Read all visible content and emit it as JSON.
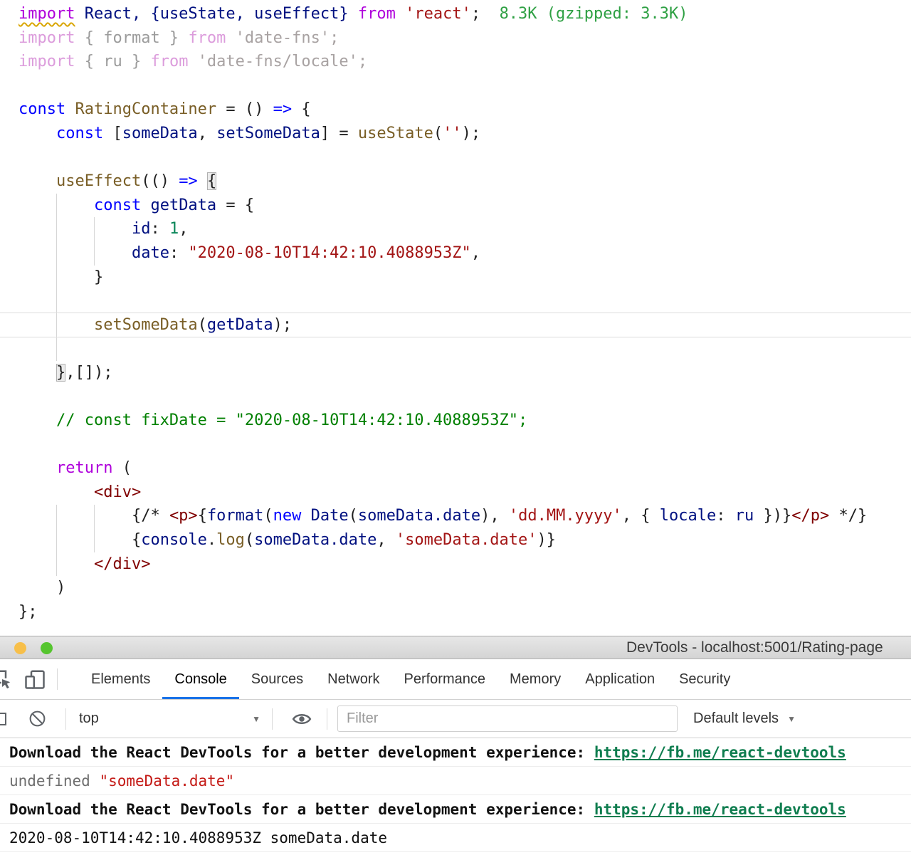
{
  "icons": {
    "caret_down": "▼"
  },
  "editor": {
    "current_line": 13,
    "guides": [
      {
        "col": 4,
        "from": 8,
        "to": 14
      },
      {
        "col": 8,
        "from": 9,
        "to": 10
      },
      {
        "col": 4,
        "from": 21,
        "to": 23
      },
      {
        "col": 8,
        "from": 21,
        "to": 22
      }
    ],
    "lines": [
      [
        {
          "t": "import",
          "c": "kw2 sq"
        },
        {
          "t": " ",
          "c": "plain"
        },
        {
          "t": "React, {useState, useEffect}",
          "c": "var"
        },
        {
          "t": " ",
          "c": "plain"
        },
        {
          "t": "from",
          "c": "kw2"
        },
        {
          "t": " ",
          "c": "plain"
        },
        {
          "t": "'react'",
          "c": "str"
        },
        {
          "t": ";",
          "c": "plain"
        },
        {
          "t": "  ",
          "c": "plain"
        },
        {
          "t": "8.3K (gzipped: 3.3K)",
          "c": "cost"
        }
      ],
      [
        {
          "t": "import",
          "c": "fkw"
        },
        {
          "t": " { format } ",
          "c": "fplain"
        },
        {
          "t": "from",
          "c": "fkw"
        },
        {
          "t": " ",
          "c": "fplain"
        },
        {
          "t": "'date-fns';",
          "c": "fstr"
        }
      ],
      [
        {
          "t": "import",
          "c": "fkw"
        },
        {
          "t": " { ru } ",
          "c": "fplain"
        },
        {
          "t": "from",
          "c": "fkw"
        },
        {
          "t": " ",
          "c": "fplain"
        },
        {
          "t": "'date-fns/locale';",
          "c": "fstr"
        }
      ],
      [],
      [
        {
          "t": "const",
          "c": "kw"
        },
        {
          "t": " ",
          "c": "plain"
        },
        {
          "t": "RatingContainer",
          "c": "fn"
        },
        {
          "t": " = () ",
          "c": "plain"
        },
        {
          "t": "=>",
          "c": "kw"
        },
        {
          "t": " {",
          "c": "plain"
        }
      ],
      [
        {
          "t": "    ",
          "c": "plain"
        },
        {
          "t": "const",
          "c": "kw"
        },
        {
          "t": " [",
          "c": "plain"
        },
        {
          "t": "someData",
          "c": "var"
        },
        {
          "t": ", ",
          "c": "plain"
        },
        {
          "t": "setSomeData",
          "c": "var"
        },
        {
          "t": "] = ",
          "c": "plain"
        },
        {
          "t": "useState",
          "c": "fn"
        },
        {
          "t": "(",
          "c": "plain"
        },
        {
          "t": "''",
          "c": "str"
        },
        {
          "t": ");",
          "c": "plain"
        }
      ],
      [],
      [
        {
          "t": "    ",
          "c": "plain"
        },
        {
          "t": "useEffect",
          "c": "fn"
        },
        {
          "t": "(() ",
          "c": "plain"
        },
        {
          "t": "=>",
          "c": "kw"
        },
        {
          "t": " ",
          "c": "plain"
        },
        {
          "t": "{",
          "c": "plain hl"
        }
      ],
      [
        {
          "t": "        ",
          "c": "plain"
        },
        {
          "t": "const",
          "c": "kw"
        },
        {
          "t": " ",
          "c": "plain"
        },
        {
          "t": "getData",
          "c": "var"
        },
        {
          "t": " = {",
          "c": "plain"
        }
      ],
      [
        {
          "t": "            ",
          "c": "plain"
        },
        {
          "t": "id",
          "c": "var"
        },
        {
          "t": ": ",
          "c": "plain"
        },
        {
          "t": "1",
          "c": "num"
        },
        {
          "t": ",",
          "c": "plain"
        }
      ],
      [
        {
          "t": "            ",
          "c": "plain"
        },
        {
          "t": "date",
          "c": "var"
        },
        {
          "t": ": ",
          "c": "plain"
        },
        {
          "t": "\"2020-08-10T14:42:10.4088953Z\"",
          "c": "str"
        },
        {
          "t": ",",
          "c": "plain"
        }
      ],
      [
        {
          "t": "        }",
          "c": "plain"
        }
      ],
      [],
      [
        {
          "t": "        ",
          "c": "plain"
        },
        {
          "t": "setSomeData",
          "c": "fn"
        },
        {
          "t": "(",
          "c": "plain"
        },
        {
          "t": "getData",
          "c": "var"
        },
        {
          "t": ");",
          "c": "plain"
        }
      ],
      [],
      [
        {
          "t": "    ",
          "c": "plain"
        },
        {
          "t": "}",
          "c": "plain hl"
        },
        {
          "t": ",[]);",
          "c": "plain"
        }
      ],
      [],
      [
        {
          "t": "    ",
          "c": "plain"
        },
        {
          "t": "// const fixDate = \"2020-08-10T14:42:10.4088953Z\";",
          "c": "comment"
        }
      ],
      [],
      [
        {
          "t": "    ",
          "c": "plain"
        },
        {
          "t": "return",
          "c": "kw2"
        },
        {
          "t": " (",
          "c": "plain"
        }
      ],
      [
        {
          "t": "        ",
          "c": "plain"
        },
        {
          "t": "<div>",
          "c": "tag"
        }
      ],
      [
        {
          "t": "            ",
          "c": "plain"
        },
        {
          "t": "{/* ",
          "c": "plain"
        },
        {
          "t": "<p>",
          "c": "tag"
        },
        {
          "t": "{",
          "c": "plain"
        },
        {
          "t": "format",
          "c": "var"
        },
        {
          "t": "(",
          "c": "plain"
        },
        {
          "t": "new",
          "c": "kw"
        },
        {
          "t": " ",
          "c": "plain"
        },
        {
          "t": "Date",
          "c": "var"
        },
        {
          "t": "(",
          "c": "plain"
        },
        {
          "t": "someData.date",
          "c": "var"
        },
        {
          "t": "), ",
          "c": "plain"
        },
        {
          "t": "'dd.MM.yyyy'",
          "c": "str"
        },
        {
          "t": ", { ",
          "c": "plain"
        },
        {
          "t": "locale",
          "c": "var"
        },
        {
          "t": ": ",
          "c": "plain"
        },
        {
          "t": "ru",
          "c": "var"
        },
        {
          "t": " })}",
          "c": "plain"
        },
        {
          "t": "</p>",
          "c": "tag"
        },
        {
          "t": " */}",
          "c": "plain"
        }
      ],
      [
        {
          "t": "            ",
          "c": "plain"
        },
        {
          "t": "{",
          "c": "plain"
        },
        {
          "t": "console",
          "c": "var"
        },
        {
          "t": ".",
          "c": "plain"
        },
        {
          "t": "log",
          "c": "fn"
        },
        {
          "t": "(",
          "c": "plain"
        },
        {
          "t": "someData.date",
          "c": "var"
        },
        {
          "t": ", ",
          "c": "plain"
        },
        {
          "t": "'someData.date'",
          "c": "str"
        },
        {
          "t": ")}",
          "c": "plain"
        }
      ],
      [
        {
          "t": "        ",
          "c": "plain"
        },
        {
          "t": "</div>",
          "c": "tag"
        }
      ],
      [
        {
          "t": "    )",
          "c": "plain"
        }
      ],
      [
        {
          "t": "};",
          "c": "plain"
        }
      ]
    ]
  },
  "devtools": {
    "window_title": "DevTools - localhost:5001/Rating-page",
    "colors": {
      "traffic_yellow": "#f7bf4a",
      "traffic_green": "#56c52f",
      "tab_accent": "#1a73e8",
      "link_green": "#0f7d4f",
      "string_red": "#c41a16"
    },
    "tabs": [
      "Elements",
      "Console",
      "Sources",
      "Network",
      "Performance",
      "Memory",
      "Application",
      "Security"
    ],
    "selected_tab": "Console",
    "toolbar": {
      "context": "top",
      "filter_placeholder": "Filter",
      "levels_label": "Default levels"
    },
    "messages": [
      {
        "parts": [
          {
            "t": "Download the React DevTools for a better development experience: ",
            "c": "m-bold"
          },
          {
            "t": "https://fb.me/react-devtools",
            "c": "m-link"
          }
        ]
      },
      {
        "parts": [
          {
            "t": "undefined ",
            "c": "m-gray"
          },
          {
            "t": "\"someData.date\"",
            "c": "m-str"
          }
        ]
      },
      {
        "parts": [
          {
            "t": "Download the React DevTools for a better development experience: ",
            "c": "m-bold"
          },
          {
            "t": "https://fb.me/react-devtools",
            "c": "m-link"
          }
        ]
      },
      {
        "parts": [
          {
            "t": "2020-08-10T14:42:10.4088953Z someData.date",
            "c": "m-plain"
          }
        ]
      }
    ]
  }
}
